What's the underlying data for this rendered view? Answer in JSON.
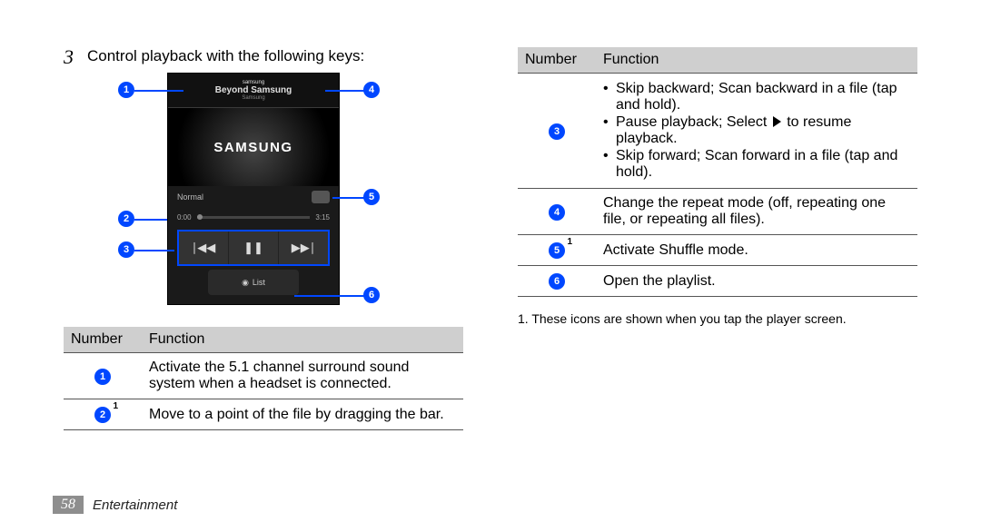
{
  "step": {
    "num": "3",
    "text": "Control playback with the following keys:"
  },
  "phone": {
    "top1": "samsung",
    "top2": "Beyond Samsung",
    "top3": "Samsung",
    "album": "SAMSUNG",
    "normal": "Normal",
    "time_left": "0:00",
    "time_right": "3:15",
    "list": "List"
  },
  "callouts": {
    "c1": "1",
    "c2": "2",
    "c3": "3",
    "c4": "4",
    "c5": "5",
    "c6": "6"
  },
  "left_table": {
    "head_num": "Number",
    "head_fn": "Function",
    "rows": [
      {
        "n": "1",
        "sup": "",
        "fn": "Activate the 5.1 channel surround sound system when a headset is connected."
      },
      {
        "n": "2",
        "sup": "1",
        "fn": "Move to a point of the file by dragging the bar."
      }
    ]
  },
  "right_table": {
    "head_num": "Number",
    "head_fn": "Function",
    "rows": [
      {
        "n": "3",
        "sup": "",
        "bullets": [
          "Skip backward; Scan backward in a file (tap and hold).",
          "Pause playback; Select __PLAY__ to resume playback.",
          "Skip forward; Scan forward in a file (tap and hold)."
        ]
      },
      {
        "n": "4",
        "sup": "",
        "fn": "Change the repeat mode (off, repeating one file, or repeating all files)."
      },
      {
        "n": "5",
        "sup": "1",
        "fn": "Activate Shuffle mode."
      },
      {
        "n": "6",
        "sup": "",
        "fn": "Open the playlist."
      }
    ]
  },
  "footnote": "1. These icons are shown when you tap the player screen.",
  "footer": {
    "page": "58",
    "section": "Entertainment"
  }
}
